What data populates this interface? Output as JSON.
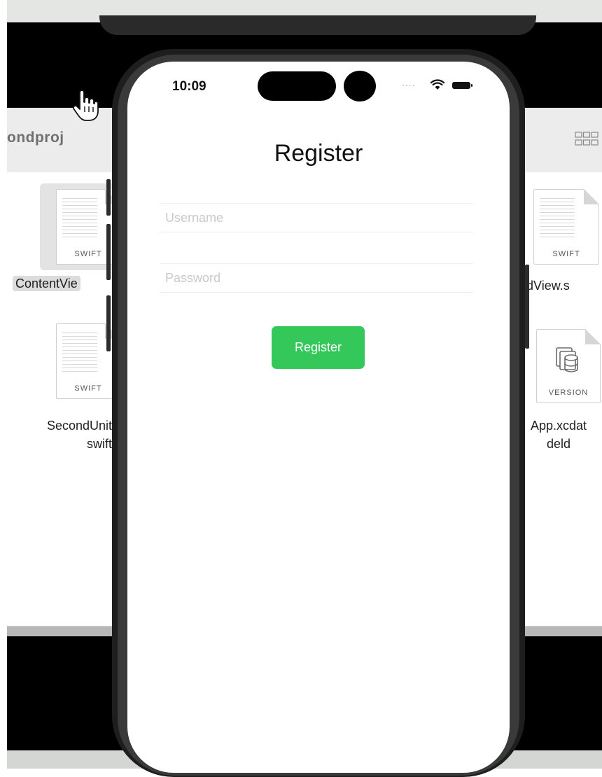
{
  "finder": {
    "title": "ondproj",
    "files": [
      {
        "name": "ContentVie",
        "type": "SWIFT"
      },
      {
        "name": "ondView.s",
        "type": "SWIFT"
      },
      {
        "name_line1": "SecondUnit",
        "name_line2": "swift",
        "type": "SWIFT"
      },
      {
        "name_line1": "App.xcdat",
        "name_line2": "deld",
        "type": "VERSION"
      }
    ]
  },
  "phone": {
    "status_bar": {
      "time": "10:09",
      "signal": "...."
    },
    "screen_title": "Register",
    "username": {
      "placeholder": "Username",
      "value": ""
    },
    "password": {
      "placeholder": "Password",
      "value": ""
    },
    "register_button": "Register",
    "accent_color": "#34c759"
  }
}
